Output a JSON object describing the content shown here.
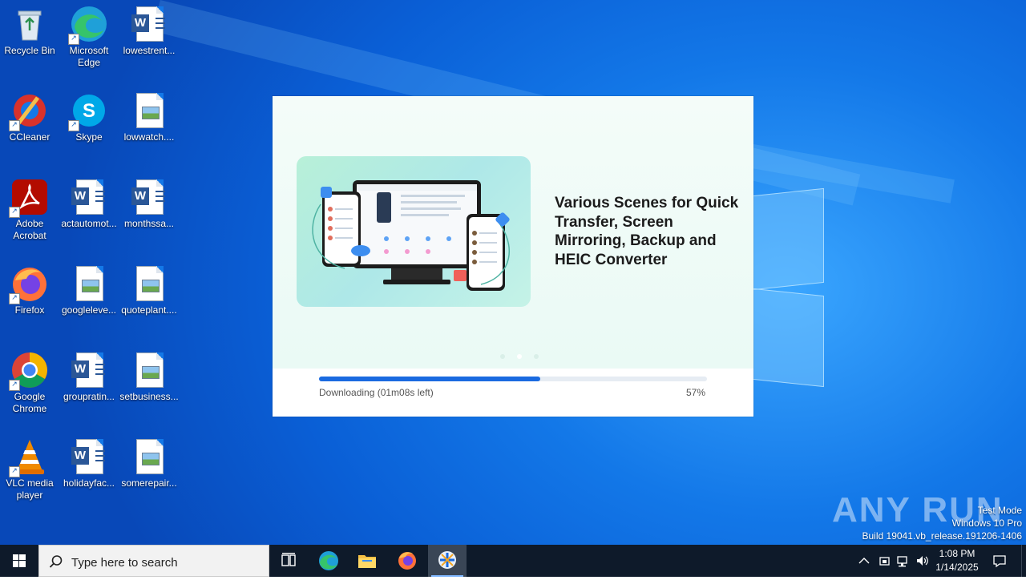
{
  "desktop": {
    "icons": [
      {
        "label": "Recycle Bin"
      },
      {
        "label": "Microsoft Edge"
      },
      {
        "label": "lowestrent..."
      },
      {
        "label": "CCleaner"
      },
      {
        "label": "Skype"
      },
      {
        "label": "lowwatch...."
      },
      {
        "label": "Adobe Acrobat"
      },
      {
        "label": "actautomot..."
      },
      {
        "label": "monthssa..."
      },
      {
        "label": "Firefox"
      },
      {
        "label": "googleleve..."
      },
      {
        "label": "quoteplant...."
      },
      {
        "label": "Google Chrome"
      },
      {
        "label": "groupratin..."
      },
      {
        "label": "setbusiness..."
      },
      {
        "label": "VLC media player"
      },
      {
        "label": "holidayfac..."
      },
      {
        "label": "somerepair..."
      }
    ]
  },
  "installer": {
    "headline": "Various Scenes for Quick Transfer, Screen Mirroring, Backup and HEIC Converter",
    "status": "Downloading (01m08s left)",
    "percent_label": "57%",
    "progress_fraction": 0.57,
    "slide_count": 3,
    "active_slide": 1
  },
  "watermark": {
    "brand": "ANY RUN",
    "line1": "Test Mode",
    "line2": "Windows 10 Pro",
    "line3": "Build 19041.vb_release.191206-1406"
  },
  "taskbar": {
    "search_placeholder": "Type here to search",
    "time": "1:08 PM",
    "date": "1/14/2025",
    "pinned": [
      "task-view-icon",
      "edge-icon",
      "file-explorer-icon",
      "firefox-icon",
      "installer-app-icon"
    ]
  },
  "colors": {
    "accent": "#1a6ae0",
    "taskbar": "#0e1a2a",
    "desktop": "#0a5fd6"
  }
}
